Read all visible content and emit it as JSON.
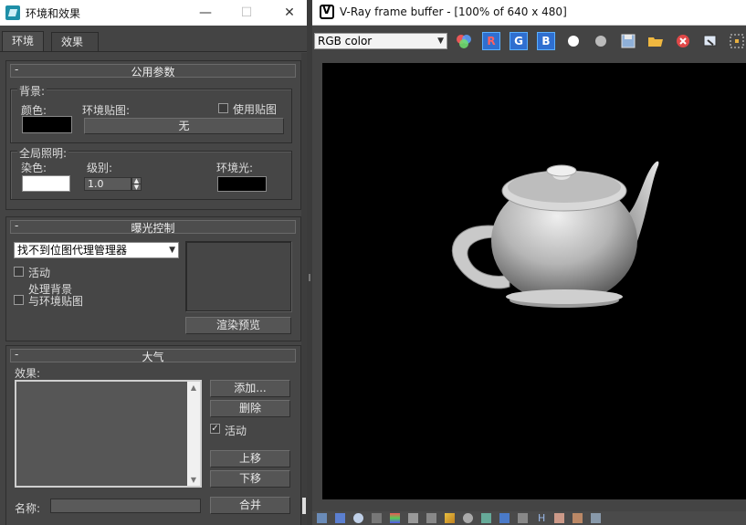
{
  "env_window": {
    "title": "环境和效果",
    "tabs": [
      {
        "label": "环境",
        "active": true
      },
      {
        "label": "效果",
        "active": false
      }
    ],
    "common_params": {
      "header": "公用参数",
      "background_group": "背景:",
      "color_label": "颜色:",
      "color_value": "#000000",
      "env_map_label": "环境贴图:",
      "use_map_label": "使用贴图",
      "use_map_checked": false,
      "env_map_button": "无",
      "global_lighting_group": "全局照明:",
      "tint_label": "染色:",
      "tint_value": "#ffffff",
      "level_label": "级别:",
      "level_value": "1.0",
      "ambient_label": "环境光:",
      "ambient_value": "#000000"
    },
    "exposure": {
      "header": "曝光控制",
      "dropdown_value": "找不到位图代理管理器",
      "active_label": "活动",
      "active_checked": false,
      "process_bg_label_1": "处理背景",
      "process_bg_label_2": "与环境贴图",
      "process_bg_checked": false,
      "render_preview_button": "渲染预览"
    },
    "atmosphere": {
      "header": "大气",
      "effects_label": "效果:",
      "add_button": "添加...",
      "delete_button": "删除",
      "active_label": "活动",
      "active_checked": true,
      "move_up_button": "上移",
      "move_down_button": "下移",
      "name_label": "名称:",
      "merge_button": "合并"
    },
    "window_buttons": {
      "minimize": "—",
      "maximize": "☐",
      "close": "✕"
    }
  },
  "vfb_window": {
    "title": "V-Ray frame buffer - [100% of 640 x 480]",
    "channel": "RGB color",
    "channel_buttons": [
      "R",
      "G",
      "B"
    ],
    "icons": [
      "color-channels-icon",
      "white-dot-icon",
      "gray-dot-icon",
      "save-icon",
      "open-folder-icon",
      "clear-icon",
      "copy-to-max-icon",
      "region-render-icon"
    ],
    "status_icons": [
      "display-icon",
      "track-mouse-icon",
      "info-icon",
      "color-correction-icon",
      "lut-icon",
      "curve-icon",
      "exposure-icon",
      "levels-icon",
      "ocio-icon",
      "srgb-icon",
      "hist-icon",
      "h-icon",
      "compare-icon",
      "stamp-icon"
    ],
    "colors": {
      "accent": "#2f6fd0",
      "render_bg": "#000000"
    }
  }
}
